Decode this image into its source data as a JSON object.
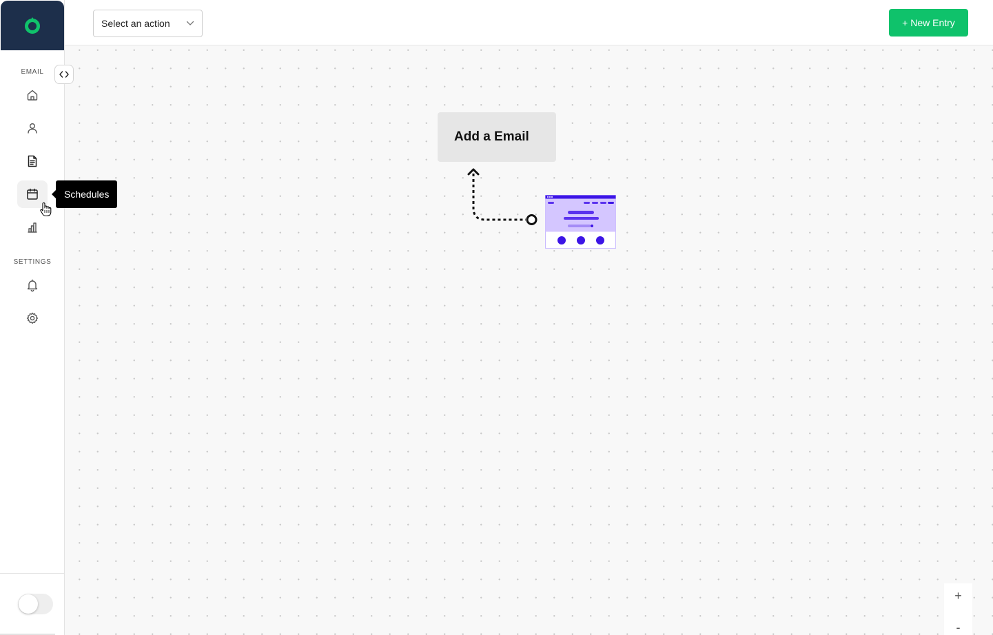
{
  "sidebar": {
    "logo_icon": "brand-logo-icon",
    "sections": [
      {
        "label": "EMAIL"
      },
      {
        "label": "SETTINGS"
      }
    ],
    "email_items": [
      {
        "icon": "home-icon"
      },
      {
        "icon": "user-icon"
      },
      {
        "icon": "document-icon"
      },
      {
        "icon": "calendar-icon",
        "active": true
      },
      {
        "icon": "bar-chart-icon"
      }
    ],
    "settings_items": [
      {
        "icon": "bell-icon"
      },
      {
        "icon": "gear-icon"
      }
    ],
    "tooltip": "Schedules",
    "collapse_icon": "code-brackets-icon"
  },
  "topbar": {
    "select_placeholder": "Select an action",
    "new_entry_label": "+ New Entry"
  },
  "canvas": {
    "add_email_label": "Add a Email"
  },
  "zoom": {
    "in_label": "+",
    "out_label": "-"
  },
  "colors": {
    "logo_bg": "#1d2f4b",
    "brand_green": "#0fc26b",
    "illustration_purple": "#3c14e6"
  }
}
